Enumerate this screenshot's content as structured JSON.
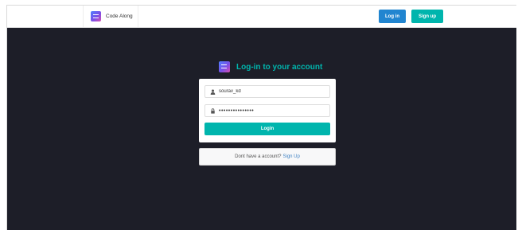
{
  "navbar": {
    "brand": "Code Along",
    "login_label": "Log in",
    "signup_label": "Sign up"
  },
  "colors": {
    "teal": "#00b5ad",
    "blue": "#2185d0",
    "background": "#1d1e28"
  },
  "login_form": {
    "title": "Log-in to your account",
    "username_value": "sourav_kd",
    "password_value": "•••••••••••••••",
    "submit_label": "Login"
  },
  "signup_prompt": {
    "text": "Dont have a account?",
    "link": "Sign Up"
  },
  "icons": [
    "app-logo-icon",
    "user-icon",
    "lock-icon"
  ]
}
